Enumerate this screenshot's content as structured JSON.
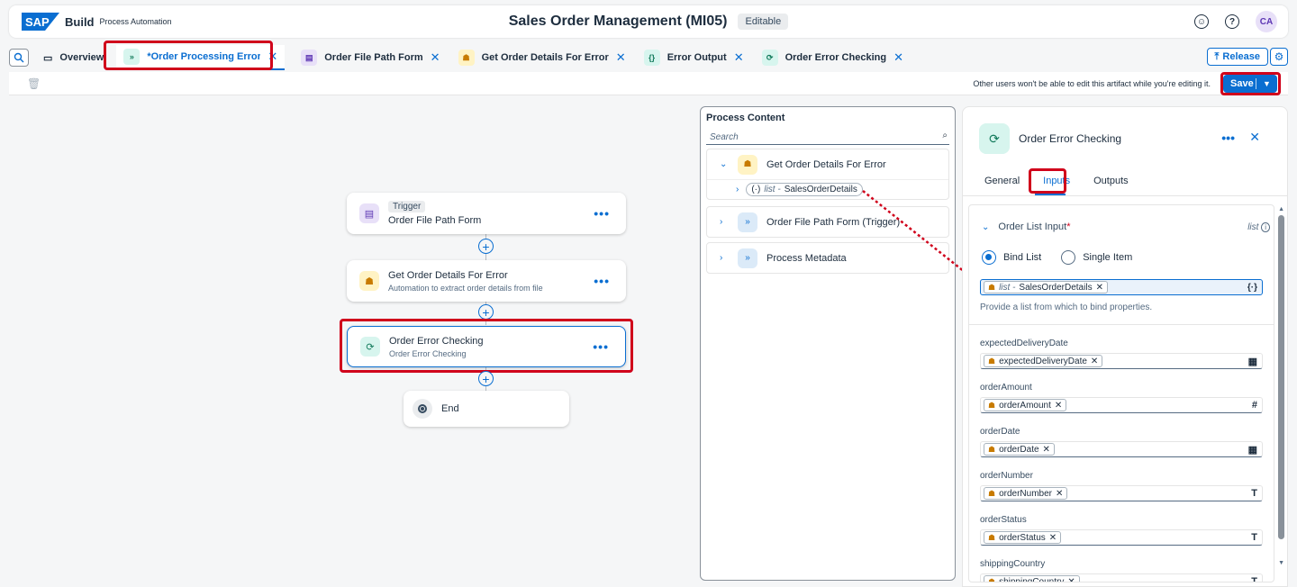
{
  "shell": {
    "logo": "SAP",
    "brand": "Build",
    "product": "Process Automation",
    "title": "Sales Order Management (MI05)",
    "badge": "Editable",
    "avatar": "CA"
  },
  "tabs": [
    {
      "label": "Overview"
    },
    {
      "label": "*Order Processing Error ..."
    },
    {
      "label": "Order File Path Form"
    },
    {
      "label": "Get Order Details For Error"
    },
    {
      "label": "Error Output"
    },
    {
      "label": "Order Error Checking"
    }
  ],
  "release_label": "Release",
  "toolbar": {
    "note": "Other users won't be able to edit this artifact while you're editing it.",
    "save_label": "Save"
  },
  "canvas": {
    "trigger_tag": "Trigger",
    "trigger_title": "Order File Path Form",
    "step1_title": "Get Order Details For Error",
    "step1_sub": "Automation to extract order details from file",
    "step2_title": "Order Error Checking",
    "step2_sub": "Order Error Checking",
    "end_label": "End"
  },
  "process_content": {
    "title": "Process Content",
    "search_placeholder": "Search",
    "group1": "Get Order Details For Error",
    "group1_sub_type": "list -",
    "group1_sub_name": "SalesOrderDetails",
    "group2": "Order File Path Form (Trigger)",
    "group3": "Process Metadata"
  },
  "panel": {
    "title": "Order Error Checking",
    "tabs": [
      "General",
      "Inputs",
      "Outputs"
    ],
    "list_input_label": "Order List Input",
    "list_input_req": "*",
    "list_input_type": "list",
    "radio_bind": "Bind List",
    "radio_single": "Single Item",
    "bind_type": "list -",
    "bind_value": "SalesOrderDetails",
    "help": "Provide a list from which to bind properties.",
    "props": [
      {
        "label": "expectedDeliveryDate",
        "token": "expectedDeliveryDate",
        "icon": "calendar-icon"
      },
      {
        "label": "orderAmount",
        "token": "orderAmount",
        "icon": "number-icon"
      },
      {
        "label": "orderDate",
        "token": "orderDate",
        "icon": "calendar-icon"
      },
      {
        "label": "orderNumber",
        "token": "orderNumber",
        "icon": "text-icon"
      },
      {
        "label": "orderStatus",
        "token": "orderStatus",
        "icon": "text-icon"
      },
      {
        "label": "shippingCountry",
        "token": "shippingCountry",
        "icon": "text-icon"
      }
    ]
  },
  "colors": {
    "accent": "#0a6ed1",
    "highlight_box": "#d0021b"
  }
}
